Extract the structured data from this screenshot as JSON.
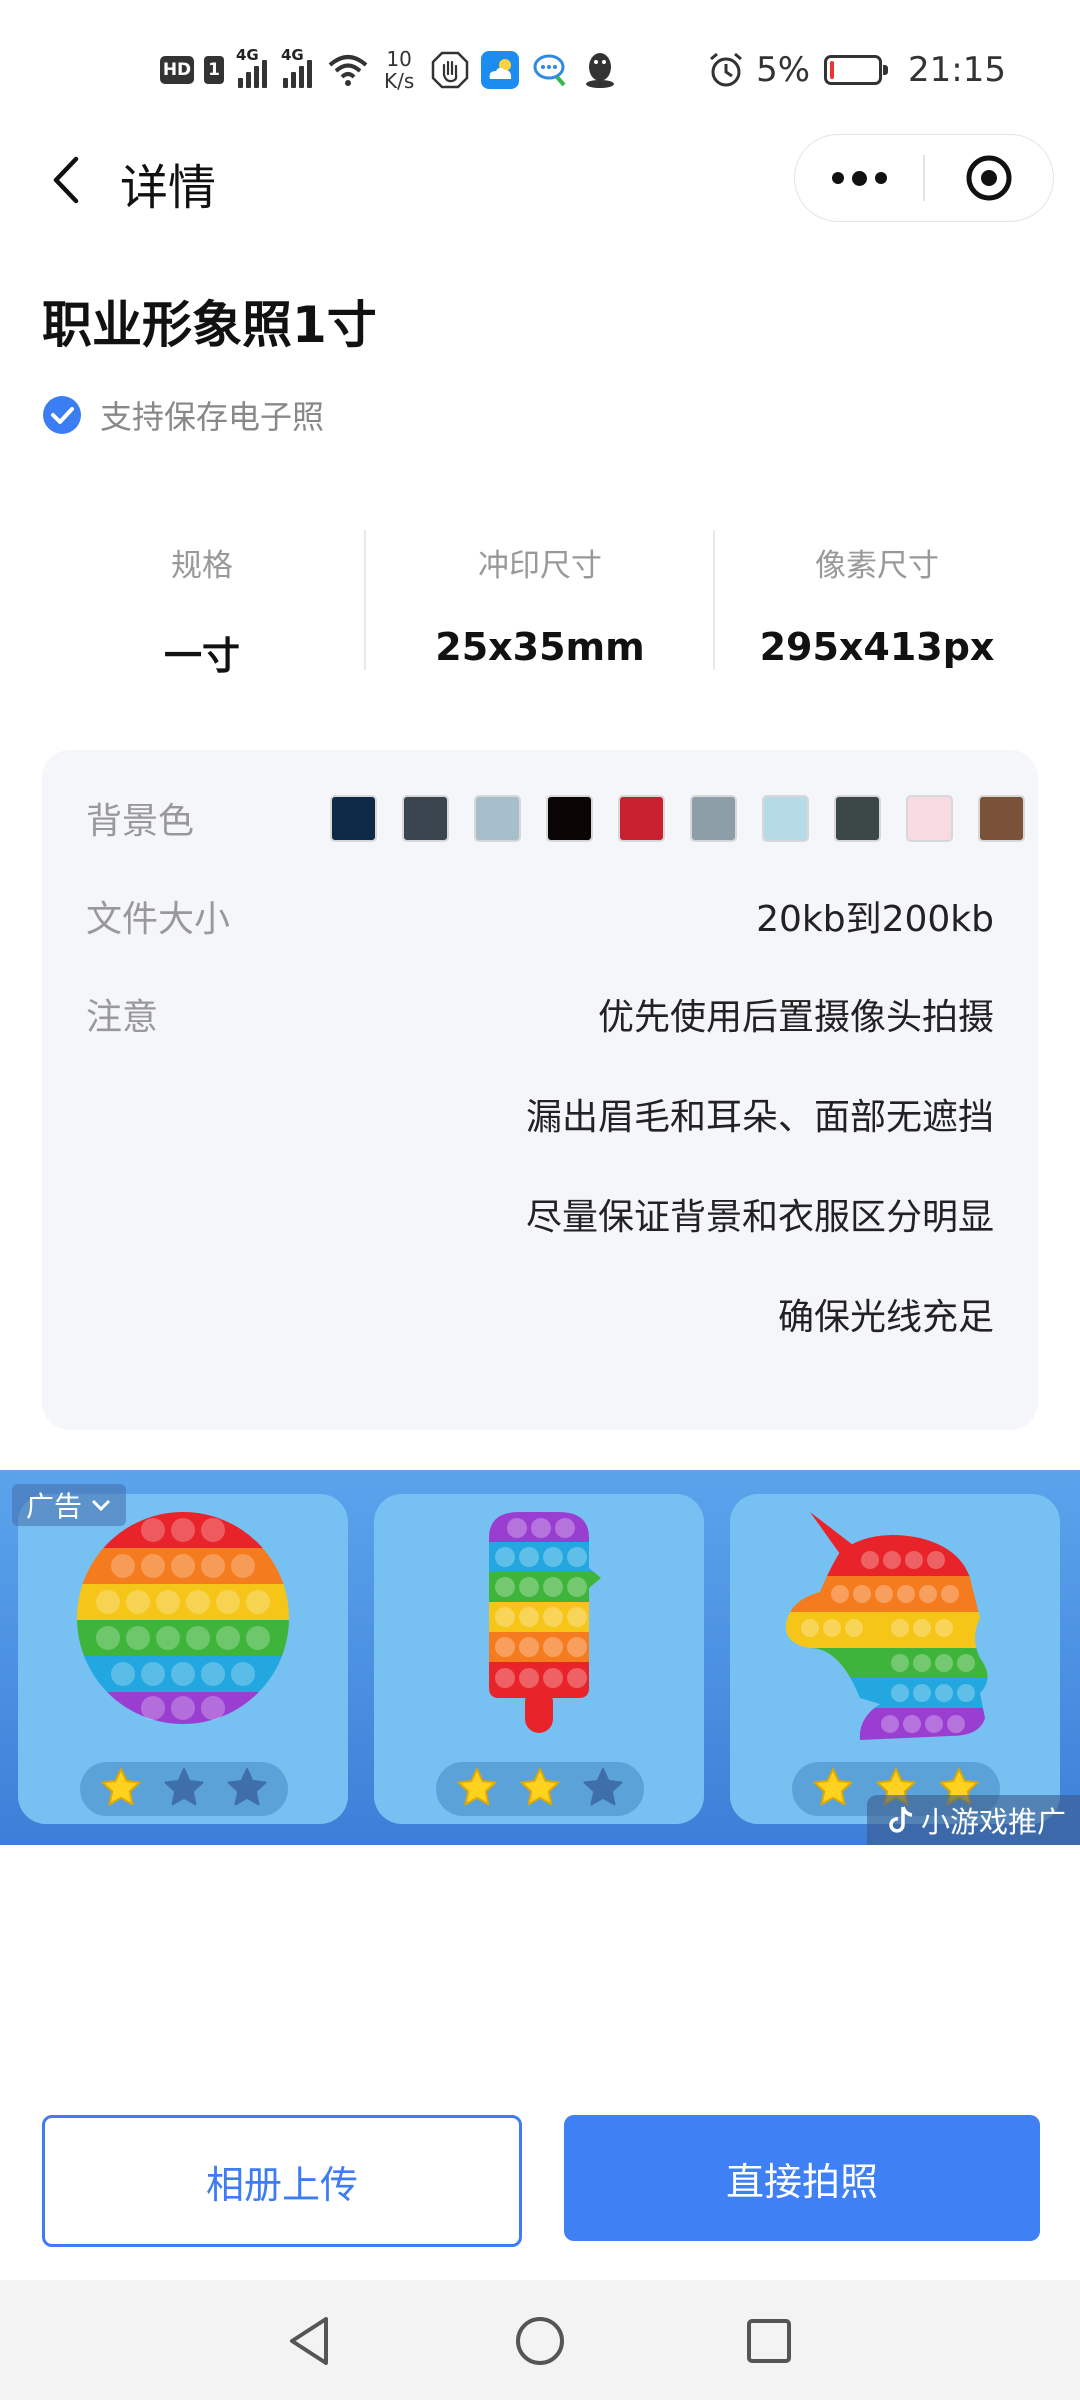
{
  "status_bar": {
    "hd_label": "HD",
    "sim_label": "1",
    "net1": "4G",
    "net2": "4G",
    "speed_value": "10",
    "speed_unit": "K/s",
    "battery_percent": "5%",
    "time": "21:15",
    "battery_level": 0.05,
    "icons": [
      "hand-icon",
      "weather-icon",
      "chat-icon",
      "qq-penguin-icon",
      "alarm-icon"
    ]
  },
  "nav": {
    "title": "详情",
    "back_icon": "chevron-left-icon",
    "more_icon": "more-dots-icon",
    "close_icon": "target-circle-icon"
  },
  "product": {
    "title": "职业形象照1寸",
    "support_text": "支持保存电子照"
  },
  "specs": [
    {
      "label": "规格",
      "value": "一寸"
    },
    {
      "label": "冲印尺寸",
      "value": "25x35mm"
    },
    {
      "label": "像素尺寸",
      "value": "295x413px"
    }
  ],
  "info": {
    "bg_label": "背景色",
    "bg_colors": [
      "#0e2948",
      "#3a4550",
      "#a7bfcb",
      "#0a0405",
      "#c8202f",
      "#8d9ea9",
      "#b5dbe6",
      "#3b4847",
      "#f8dbe2",
      "#7a5237"
    ],
    "size_label": "文件大小",
    "size_value": "20kb到200kb",
    "note_label": "注意",
    "notes": [
      "优先使用后置摄像头拍摄",
      "漏出眉毛和耳朵、面部无遮挡",
      "尽量保证背景和衣服区分明显",
      "确保光线充足"
    ]
  },
  "ad": {
    "tag": "广告",
    "promo": "小游戏推广",
    "tiles": [
      {
        "toy": "circle-popit",
        "stars_filled": 1
      },
      {
        "toy": "popsicle-popit",
        "stars_filled": 2
      },
      {
        "toy": "unicorn-popit",
        "stars_filled": 3
      }
    ]
  },
  "buttons": {
    "album": "相册上传",
    "camera": "直接拍照"
  },
  "system_nav": [
    "back-triangle-icon",
    "home-circle-icon",
    "recents-square-icon"
  ]
}
